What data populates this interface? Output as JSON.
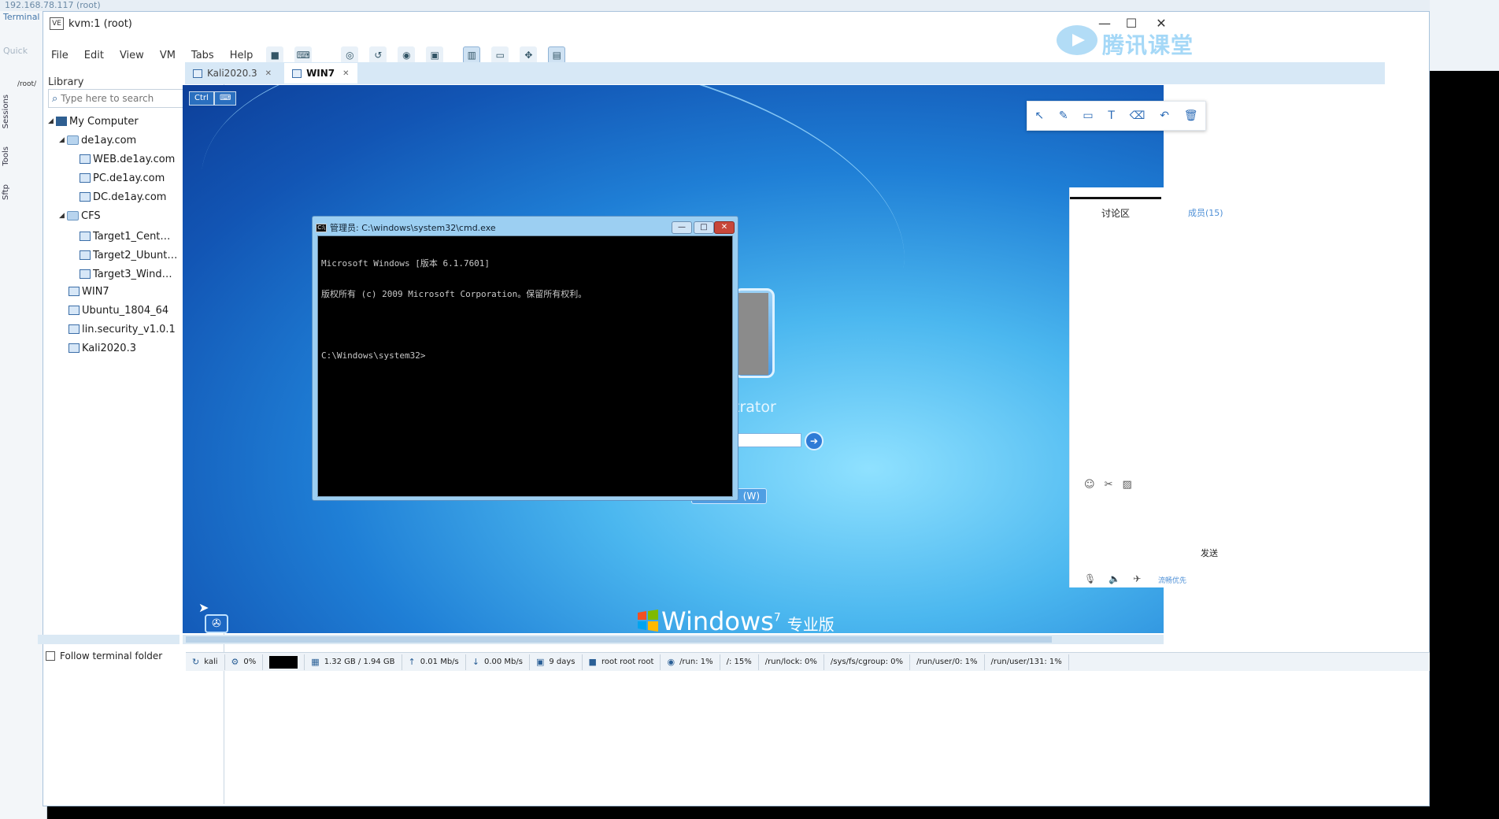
{
  "background_app": {
    "title": "192.168.78.117 (root)",
    "terminal_label": "Terminal",
    "quick_label": "Quick",
    "path_label": "/root/",
    "side_tabs": [
      "Sessions",
      "Tools",
      "Sftp"
    ]
  },
  "window": {
    "title": "kvm:1 (root)",
    "logo_text": "VE",
    "minimize": "—",
    "maximize": "☐",
    "close": "✕"
  },
  "menu": {
    "items": [
      "File",
      "Edit",
      "View",
      "VM",
      "Tabs",
      "Help"
    ]
  },
  "library": {
    "title": "Library",
    "close": "✕",
    "search_placeholder": "Type here to search",
    "tree": [
      {
        "label": "My Computer",
        "type": "computer",
        "level": 0,
        "expanded": true
      },
      {
        "label": "de1ay.com",
        "type": "folder",
        "level": 1,
        "expanded": true
      },
      {
        "label": "WEB.de1ay.com",
        "type": "vm",
        "level": 2
      },
      {
        "label": "PC.de1ay.com",
        "type": "vm",
        "level": 2
      },
      {
        "label": "DC.de1ay.com",
        "type": "vm",
        "level": 2
      },
      {
        "label": "CFS",
        "type": "folder",
        "level": 1,
        "expanded": true
      },
      {
        "label": "Target1_Cent…",
        "type": "vm",
        "level": 2
      },
      {
        "label": "Target2_Ubunt…",
        "type": "vm",
        "level": 2
      },
      {
        "label": "Target3_Wind…",
        "type": "vm",
        "level": 2
      },
      {
        "label": "WIN7",
        "type": "vm",
        "level": 1
      },
      {
        "label": "Ubuntu_1804_64",
        "type": "vm",
        "level": 1
      },
      {
        "label": "lin.security_v1.0.1",
        "type": "vm",
        "level": 1
      },
      {
        "label": "Kali2020.3",
        "type": "vm",
        "level": 1
      }
    ],
    "follow_label": "Follow terminal folder"
  },
  "tabs": [
    {
      "label": "Kali2020.3",
      "active": false
    },
    {
      "label": "WIN7",
      "active": true
    }
  ],
  "vm_screen": {
    "chips": [
      "Ctrl",
      "⌨"
    ],
    "user_name_partial": "trator",
    "switch_partial": "(W)",
    "brand": "Windows",
    "brand_sup": "7",
    "edition": "专业版"
  },
  "cmd": {
    "title": "管理员: C:\\windows\\system32\\cmd.exe",
    "icon_text": "C:\\",
    "lines": [
      "Microsoft Windows [版本 6.1.7601]",
      "版权所有 (c) 2009 Microsoft Corporation。保留所有权利。",
      "",
      "C:\\Windows\\system32>"
    ],
    "btn_min": "—",
    "btn_max": "□",
    "btn_close": "✕"
  },
  "draw_toolbar": {
    "tools": [
      "↖",
      "✎",
      "▭",
      "T",
      "⌫",
      "↶",
      "🗑"
    ]
  },
  "discussion": {
    "title": "讨论区",
    "members": "成员(15)",
    "send": "发送",
    "quality": "流畅优先"
  },
  "watermark": {
    "text": "腾讯课堂"
  },
  "statusbar": {
    "items": [
      {
        "icon": "↻",
        "text": "kali"
      },
      {
        "icon": "⚙",
        "text": "0%"
      },
      {
        "icon": "▦",
        "text": "1.32 GB / 1.94 GB"
      },
      {
        "icon": "↑",
        "text": "0.01 Mb/s"
      },
      {
        "icon": "↓",
        "text": "0.00 Mb/s"
      },
      {
        "icon": "▣",
        "text": "9 days"
      },
      {
        "icon": "■",
        "text": "root  root  root"
      },
      {
        "icon": "◉",
        "text": "/run: 1%"
      },
      {
        "icon": "",
        "text": "/: 15%"
      },
      {
        "icon": "",
        "text": "/run/lock: 0%"
      },
      {
        "icon": "",
        "text": "/sys/fs/cgroup: 0%"
      },
      {
        "icon": "",
        "text": "/run/user/0: 1%"
      },
      {
        "icon": "",
        "text": "/run/user/131: 1%"
      }
    ]
  }
}
